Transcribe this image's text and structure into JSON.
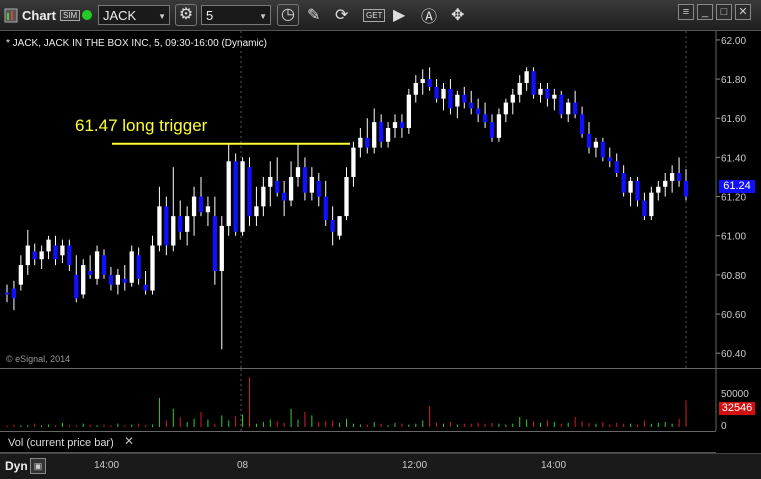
{
  "toolbar": {
    "app_label": "Chart",
    "sim_badge": "SIM",
    "symbol": "JACK",
    "interval": "5"
  },
  "chart": {
    "header": "* JACK, JACK IN THE BOX INC, 5, 09:30-16:00 (Dynamic)",
    "annotation": "61.47 long trigger",
    "annotation_color": "#ffff33",
    "copyright": "© eSignal, 2014",
    "last_price_label": "61.24",
    "price_ticks": [
      "62.00",
      "61.80",
      "61.60",
      "61.40",
      "61.20",
      "61.00",
      "60.80",
      "60.60",
      "60.40"
    ],
    "up_color": "#ffffff",
    "down_color": "#1010ff"
  },
  "volume": {
    "panel_label": "Vol (current price bar)",
    "ticks": [
      "50000",
      "0"
    ],
    "last_volume_label": "32546"
  },
  "time_axis": {
    "ticks": [
      "14:00",
      "08",
      "12:00",
      "14:00"
    ],
    "dyn_label": "Dyn"
  },
  "chart_data": {
    "type": "candlestick",
    "ylim": [
      60.35,
      62.02
    ],
    "trigger_level": 61.47,
    "last_price": 61.24,
    "last_volume": 32546,
    "ohlc": [
      [
        60.71,
        60.75,
        60.66,
        60.7
      ],
      [
        60.73,
        60.77,
        60.62,
        60.68
      ],
      [
        60.75,
        60.9,
        60.72,
        60.85
      ],
      [
        60.85,
        61.03,
        60.8,
        60.95
      ],
      [
        60.92,
        60.96,
        60.85,
        60.88
      ],
      [
        60.88,
        60.95,
        60.83,
        60.92
      ],
      [
        60.92,
        61.0,
        60.88,
        60.98
      ],
      [
        60.95,
        61.0,
        60.85,
        60.88
      ],
      [
        60.9,
        60.98,
        60.86,
        60.95
      ],
      [
        60.95,
        60.98,
        60.82,
        60.85
      ],
      [
        60.8,
        60.9,
        60.66,
        60.68
      ],
      [
        60.7,
        60.88,
        60.68,
        60.85
      ],
      [
        60.82,
        60.9,
        60.78,
        60.8
      ],
      [
        60.78,
        60.95,
        60.75,
        60.92
      ],
      [
        60.9,
        60.93,
        60.78,
        60.8
      ],
      [
        60.8,
        60.84,
        60.72,
        60.75
      ],
      [
        60.75,
        60.83,
        60.7,
        60.8
      ],
      [
        60.78,
        60.85,
        60.72,
        60.76
      ],
      [
        60.76,
        60.95,
        60.74,
        60.92
      ],
      [
        60.9,
        60.94,
        60.75,
        60.78
      ],
      [
        60.75,
        60.82,
        60.7,
        60.72
      ],
      [
        60.72,
        61.0,
        60.7,
        60.95
      ],
      [
        60.95,
        61.25,
        60.92,
        61.15
      ],
      [
        61.15,
        61.2,
        60.9,
        60.95
      ],
      [
        60.95,
        61.35,
        60.92,
        61.1
      ],
      [
        61.1,
        61.18,
        60.98,
        61.02
      ],
      [
        61.02,
        61.15,
        60.95,
        61.1
      ],
      [
        61.1,
        61.25,
        61.0,
        61.2
      ],
      [
        61.2,
        61.3,
        61.1,
        61.12
      ],
      [
        61.12,
        61.2,
        61.05,
        61.15
      ],
      [
        61.1,
        61.2,
        60.75,
        60.82
      ],
      [
        60.82,
        61.1,
        60.42,
        61.05
      ],
      [
        61.05,
        61.47,
        61.0,
        61.38
      ],
      [
        61.38,
        61.42,
        61.0,
        61.02
      ],
      [
        61.02,
        61.4,
        61.0,
        61.38
      ],
      [
        61.35,
        61.4,
        61.05,
        61.1
      ],
      [
        61.1,
        61.25,
        61.05,
        61.15
      ],
      [
        61.15,
        61.3,
        61.1,
        61.25
      ],
      [
        61.25,
        61.38,
        61.15,
        61.3
      ],
      [
        61.28,
        61.4,
        61.2,
        61.22
      ],
      [
        61.22,
        61.28,
        61.1,
        61.18
      ],
      [
        61.18,
        61.38,
        61.15,
        61.3
      ],
      [
        61.3,
        61.47,
        61.25,
        61.35
      ],
      [
        61.35,
        61.4,
        61.18,
        61.22
      ],
      [
        61.22,
        61.35,
        61.18,
        61.3
      ],
      [
        61.28,
        61.32,
        61.15,
        61.2
      ],
      [
        61.2,
        61.28,
        61.05,
        61.08
      ],
      [
        61.08,
        61.15,
        60.95,
        61.02
      ],
      [
        61.0,
        61.1,
        60.98,
        61.1
      ],
      [
        61.1,
        61.35,
        61.08,
        61.3
      ],
      [
        61.3,
        61.48,
        61.25,
        61.45
      ],
      [
        61.45,
        61.55,
        61.4,
        61.5
      ],
      [
        61.5,
        61.6,
        61.42,
        61.45
      ],
      [
        61.45,
        61.65,
        61.42,
        61.58
      ],
      [
        61.58,
        61.62,
        61.45,
        61.48
      ],
      [
        61.48,
        61.58,
        61.45,
        61.55
      ],
      [
        61.55,
        61.62,
        61.5,
        61.58
      ],
      [
        61.58,
        61.62,
        61.5,
        61.55
      ],
      [
        61.55,
        61.75,
        61.52,
        61.72
      ],
      [
        61.72,
        61.82,
        61.68,
        61.78
      ],
      [
        61.78,
        61.85,
        61.72,
        61.8
      ],
      [
        61.8,
        61.86,
        61.74,
        61.76
      ],
      [
        61.76,
        61.8,
        61.68,
        61.7
      ],
      [
        61.7,
        61.78,
        61.64,
        61.75
      ],
      [
        61.75,
        61.8,
        61.62,
        61.65
      ],
      [
        61.66,
        61.74,
        61.6,
        61.72
      ],
      [
        61.72,
        61.76,
        61.65,
        61.68
      ],
      [
        61.68,
        61.74,
        61.62,
        61.65
      ],
      [
        61.65,
        61.7,
        61.58,
        61.62
      ],
      [
        61.62,
        61.68,
        61.55,
        61.58
      ],
      [
        61.58,
        61.62,
        61.48,
        61.5
      ],
      [
        61.5,
        61.65,
        61.48,
        61.62
      ],
      [
        61.62,
        61.7,
        61.58,
        61.68
      ],
      [
        61.68,
        61.75,
        61.62,
        61.72
      ],
      [
        61.72,
        61.82,
        61.68,
        61.78
      ],
      [
        61.78,
        61.86,
        61.74,
        61.84
      ],
      [
        61.84,
        61.86,
        61.7,
        61.72
      ],
      [
        61.72,
        61.78,
        61.68,
        61.75
      ],
      [
        61.75,
        61.78,
        61.66,
        61.7
      ],
      [
        61.7,
        61.75,
        61.64,
        61.72
      ],
      [
        61.72,
        61.74,
        61.6,
        61.62
      ],
      [
        61.62,
        61.7,
        61.58,
        61.68
      ],
      [
        61.68,
        61.74,
        61.6,
        61.62
      ],
      [
        61.62,
        61.66,
        61.5,
        61.52
      ],
      [
        61.52,
        61.58,
        61.42,
        61.45
      ],
      [
        61.45,
        61.5,
        61.4,
        61.48
      ],
      [
        61.48,
        61.5,
        61.38,
        61.4
      ],
      [
        61.4,
        61.45,
        61.35,
        61.38
      ],
      [
        61.38,
        61.42,
        61.3,
        61.32
      ],
      [
        61.32,
        61.36,
        61.2,
        61.22
      ],
      [
        61.22,
        61.3,
        61.15,
        61.28
      ],
      [
        61.28,
        61.3,
        61.15,
        61.18
      ],
      [
        61.18,
        61.22,
        61.08,
        61.1
      ],
      [
        61.1,
        61.25,
        61.08,
        61.22
      ],
      [
        61.22,
        61.28,
        61.18,
        61.25
      ],
      [
        61.25,
        61.32,
        61.2,
        61.28
      ],
      [
        61.28,
        61.36,
        61.22,
        61.32
      ],
      [
        61.32,
        61.4,
        61.25,
        61.28
      ],
      [
        61.28,
        61.34,
        61.18,
        61.2
      ]
    ],
    "volume": [
      2,
      3,
      2,
      2,
      4,
      2,
      3,
      2,
      5,
      2,
      2,
      4,
      3,
      2,
      3,
      2,
      4,
      2,
      3,
      4,
      2,
      3,
      35,
      8,
      22,
      12,
      6,
      10,
      18,
      9,
      4,
      14,
      8,
      13,
      15,
      60,
      4,
      6,
      9,
      7,
      5,
      22,
      9,
      18,
      14,
      6,
      7,
      8,
      5,
      10,
      4,
      3,
      3,
      6,
      4,
      2,
      5,
      4,
      3,
      4,
      8,
      25,
      5,
      4,
      6,
      3,
      4,
      4,
      5,
      4,
      5,
      4,
      3,
      4,
      12,
      9,
      7,
      5,
      8,
      6,
      4,
      5,
      12,
      7,
      5,
      4,
      6,
      3,
      5,
      4,
      4,
      3,
      8,
      4,
      5,
      6,
      4,
      10,
      32
    ]
  }
}
